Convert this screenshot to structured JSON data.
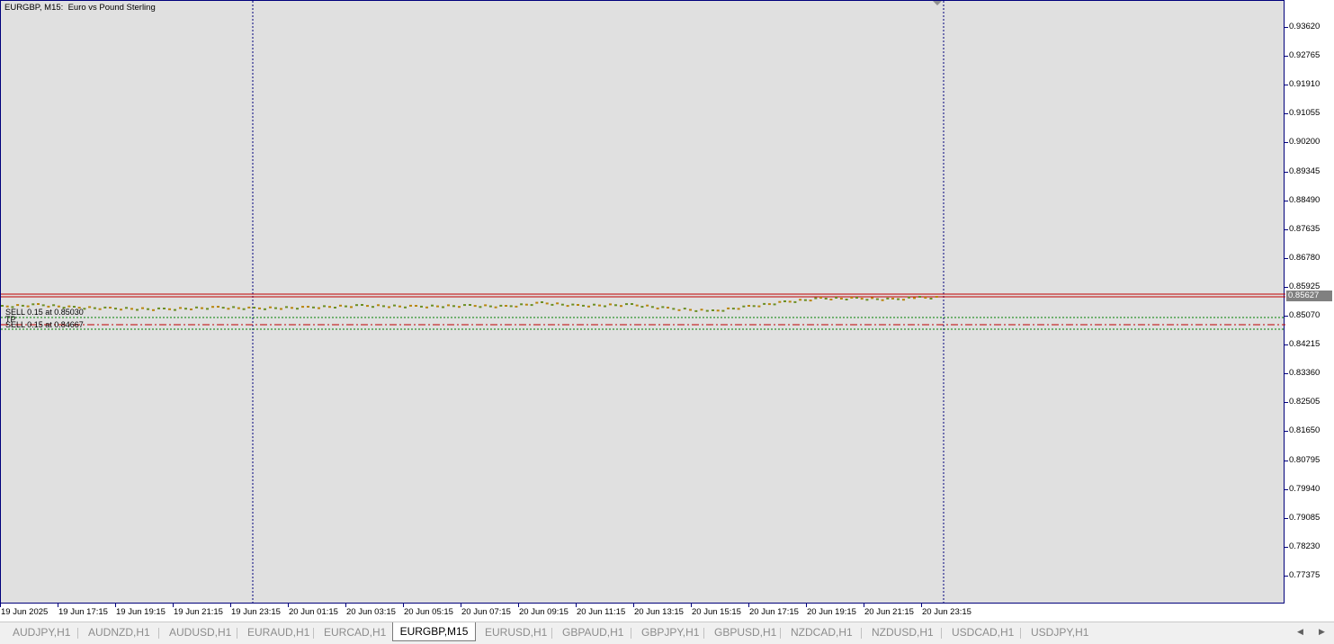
{
  "chart": {
    "title": "EURGBP, M15:  Euro vs Pound Sterling",
    "symbol": "EURGBP",
    "timeframe": "M15",
    "background_color": "#e0e0e0",
    "axis_color": "#00007b",
    "current_price": "0.85627",
    "price_axis": [
      "0.93620",
      "0.92765",
      "0.91910",
      "0.91055",
      "0.90200",
      "0.89345",
      "0.88490",
      "0.87635",
      "0.86780",
      "0.85925",
      "0.85070",
      "0.84215",
      "0.83360",
      "0.82505",
      "0.81650",
      "0.80795",
      "0.79940",
      "0.79085",
      "0.78230",
      "0.77375"
    ],
    "time_axis": [
      "19 Jun 2025",
      "19 Jun 17:15",
      "19 Jun 19:15",
      "19 Jun 21:15",
      "19 Jun 23:15",
      "20 Jun 01:15",
      "20 Jun 03:15",
      "20 Jun 05:15",
      "20 Jun 07:15",
      "20 Jun 09:15",
      "20 Jun 11:15",
      "20 Jun 13:15",
      "20 Jun 15:15",
      "20 Jun 17:15",
      "20 Jun 19:15",
      "20 Jun 21:15",
      "20 Jun 23:15"
    ],
    "price_line_color": "#c00000",
    "candle_up_color": "#6b8e23",
    "candle_down_color": "#b8860b",
    "trade_levels": [
      {
        "label": "SELL 0.15 at 0.85030",
        "color": "#008000",
        "style": "dotted"
      },
      {
        "label": "TP",
        "color": "#008000",
        "style": "dotted"
      },
      {
        "label": "SELL 0.15 at 0.84667",
        "color": "#c00000",
        "style": "dashdot"
      }
    ]
  },
  "tabs": [
    {
      "label": "AUDJPY,H1",
      "active": false
    },
    {
      "label": "AUDNZD,H1",
      "active": false
    },
    {
      "label": "AUDUSD,H1",
      "active": false
    },
    {
      "label": "EURAUD,H1",
      "active": false
    },
    {
      "label": "EURCAD,H1",
      "active": false
    },
    {
      "label": "EURGBP,M15",
      "active": true
    },
    {
      "label": "EURUSD,H1",
      "active": false
    },
    {
      "label": "GBPAUD,H1",
      "active": false
    },
    {
      "label": "GBPJPY,H1",
      "active": false
    },
    {
      "label": "GBPUSD,H1",
      "active": false
    },
    {
      "label": "NZDCAD,H1",
      "active": false
    },
    {
      "label": "NZDUSD,H1",
      "active": false
    },
    {
      "label": "USDCAD,H1",
      "active": false
    },
    {
      "label": "USDJPY,H1",
      "active": false
    }
  ],
  "tab_scroll": {
    "left_icon": "scroll-left-icon",
    "right_icon": "scroll-right-icon"
  }
}
